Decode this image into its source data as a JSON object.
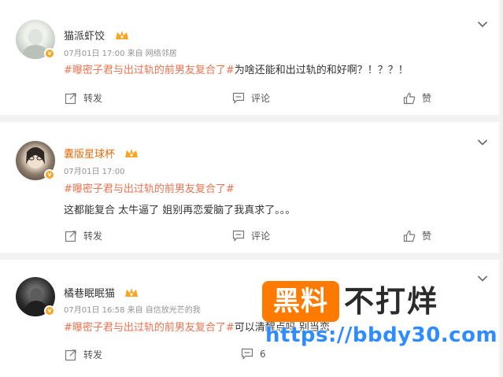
{
  "posts": [
    {
      "username": "猫派虾饺",
      "vip": false,
      "meta": "07月01日 17:00  来自 网络邻居",
      "topic": "#曝密子君与出过轨的前男友复合了#",
      "body": "为啥还能和出过轨的和好啊？！？？！",
      "repost_label": "转发",
      "comment_label": "评论",
      "like_label": "赞"
    },
    {
      "username": "囊版星球杯",
      "vip": true,
      "meta": "07月01日 17:00",
      "topic": "#曝密子君与出过轨的前男友复合了#",
      "body": "这都能复合 太牛逼了 姐别再恋爱脑了我真求了。。。",
      "repost_label": "转发",
      "comment_label": "评论",
      "like_label": "赞"
    },
    {
      "username": "橘巷眠眠猫",
      "vip": false,
      "meta": "07月01日 16:58  来自 自信放光芒的我",
      "topic": "#曝密子君与出过轨的前男友复合了#",
      "body": "可以清醒点吗 别当恋",
      "repost_label": "转发",
      "comment_count": "6"
    }
  ],
  "watermark": {
    "badge": "黑料",
    "title": "不打烊",
    "url": "https://bbdy30.com"
  },
  "colors": {
    "topic": "#eb7350",
    "vip_name": "#e86b0f",
    "meta": "#939393",
    "crown": "#f5a623",
    "watermark_orange": "#ff7a00",
    "watermark_url": "#2f8cff"
  }
}
